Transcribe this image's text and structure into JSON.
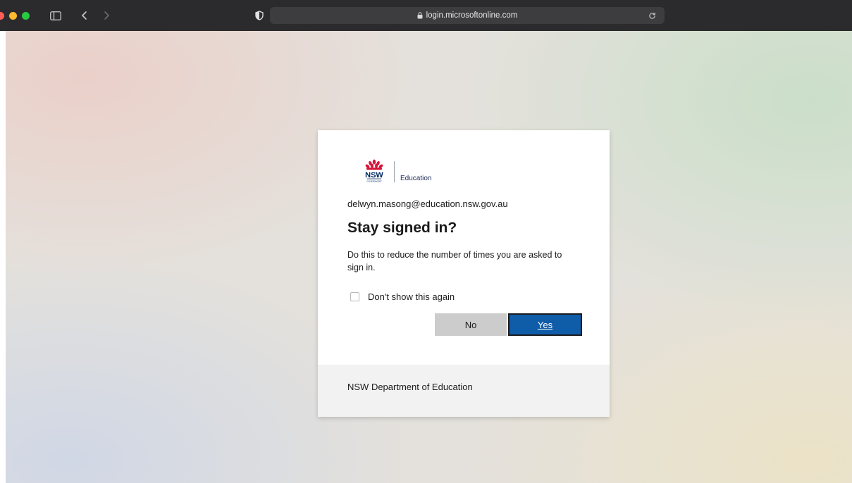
{
  "browser": {
    "url": "login.microsoftonline.com",
    "icons": [
      "sidebar-icon",
      "back-icon",
      "forward-icon",
      "privacy-shield-icon",
      "lock-icon",
      "reload-icon"
    ]
  },
  "card": {
    "logo": {
      "org_mark": "NSW",
      "org_mark_sub": "GOVERNMENT",
      "dept": "Education"
    },
    "email": "delwyn.masong@education.nsw.gov.au",
    "title": "Stay signed in?",
    "description": "Do this to reduce the number of times you are asked to sign in.",
    "checkbox_label": "Don't show this again",
    "checkbox_checked": false,
    "no_label": "No",
    "yes_label": "Yes",
    "footer_text": "NSW Department of Education"
  },
  "colors": {
    "primary_button": "#0f5ca9",
    "secondary_button": "#cccccc",
    "waratah_red": "#d7153a",
    "nsw_navy": "#002664"
  }
}
